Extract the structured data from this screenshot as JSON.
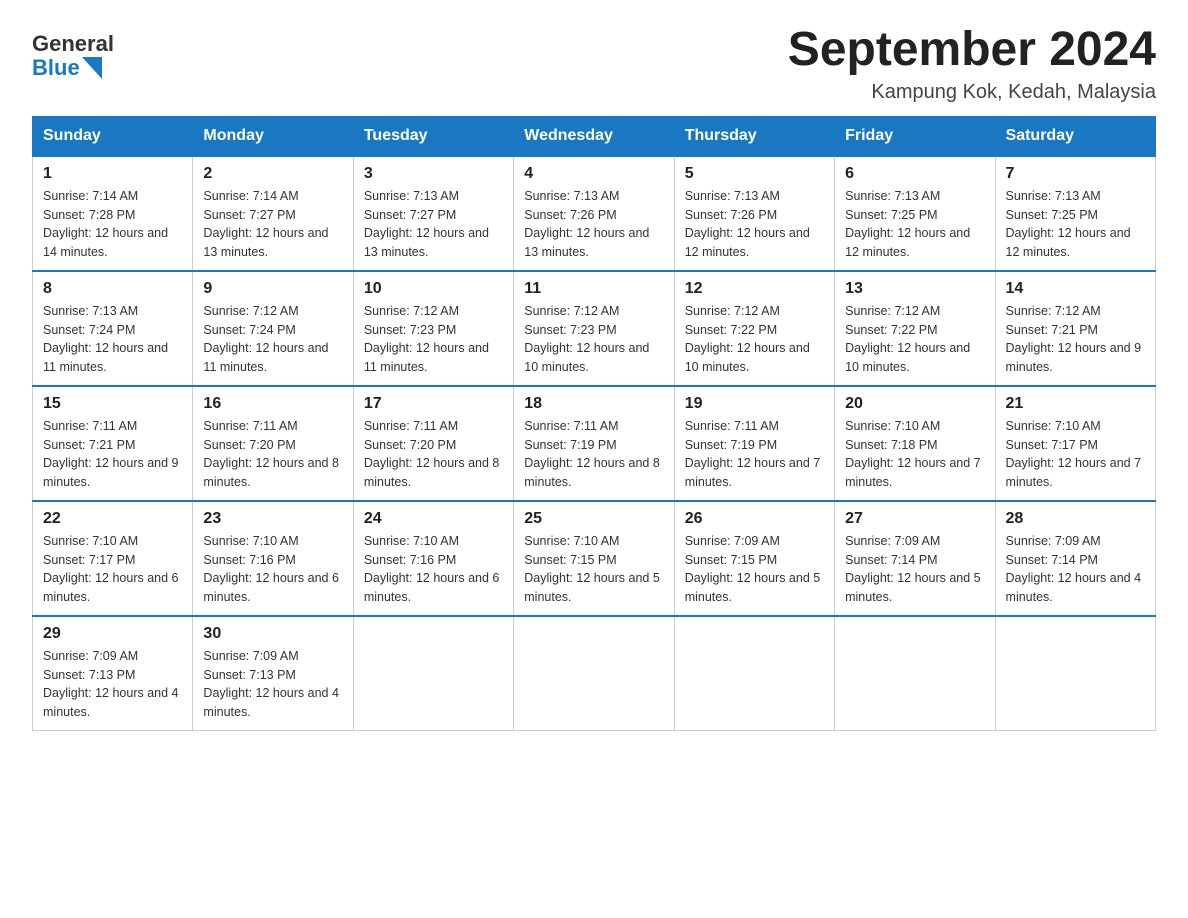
{
  "logo": {
    "text_general": "General",
    "text_blue": "Blue"
  },
  "title": "September 2024",
  "location": "Kampung Kok, Kedah, Malaysia",
  "days_of_week": [
    "Sunday",
    "Monday",
    "Tuesday",
    "Wednesday",
    "Thursday",
    "Friday",
    "Saturday"
  ],
  "weeks": [
    [
      {
        "day": "1",
        "sunrise": "7:14 AM",
        "sunset": "7:28 PM",
        "daylight": "12 hours and 14 minutes."
      },
      {
        "day": "2",
        "sunrise": "7:14 AM",
        "sunset": "7:27 PM",
        "daylight": "12 hours and 13 minutes."
      },
      {
        "day": "3",
        "sunrise": "7:13 AM",
        "sunset": "7:27 PM",
        "daylight": "12 hours and 13 minutes."
      },
      {
        "day": "4",
        "sunrise": "7:13 AM",
        "sunset": "7:26 PM",
        "daylight": "12 hours and 13 minutes."
      },
      {
        "day": "5",
        "sunrise": "7:13 AM",
        "sunset": "7:26 PM",
        "daylight": "12 hours and 12 minutes."
      },
      {
        "day": "6",
        "sunrise": "7:13 AM",
        "sunset": "7:25 PM",
        "daylight": "12 hours and 12 minutes."
      },
      {
        "day": "7",
        "sunrise": "7:13 AM",
        "sunset": "7:25 PM",
        "daylight": "12 hours and 12 minutes."
      }
    ],
    [
      {
        "day": "8",
        "sunrise": "7:13 AM",
        "sunset": "7:24 PM",
        "daylight": "12 hours and 11 minutes."
      },
      {
        "day": "9",
        "sunrise": "7:12 AM",
        "sunset": "7:24 PM",
        "daylight": "12 hours and 11 minutes."
      },
      {
        "day": "10",
        "sunrise": "7:12 AM",
        "sunset": "7:23 PM",
        "daylight": "12 hours and 11 minutes."
      },
      {
        "day": "11",
        "sunrise": "7:12 AM",
        "sunset": "7:23 PM",
        "daylight": "12 hours and 10 minutes."
      },
      {
        "day": "12",
        "sunrise": "7:12 AM",
        "sunset": "7:22 PM",
        "daylight": "12 hours and 10 minutes."
      },
      {
        "day": "13",
        "sunrise": "7:12 AM",
        "sunset": "7:22 PM",
        "daylight": "12 hours and 10 minutes."
      },
      {
        "day": "14",
        "sunrise": "7:12 AM",
        "sunset": "7:21 PM",
        "daylight": "12 hours and 9 minutes."
      }
    ],
    [
      {
        "day": "15",
        "sunrise": "7:11 AM",
        "sunset": "7:21 PM",
        "daylight": "12 hours and 9 minutes."
      },
      {
        "day": "16",
        "sunrise": "7:11 AM",
        "sunset": "7:20 PM",
        "daylight": "12 hours and 8 minutes."
      },
      {
        "day": "17",
        "sunrise": "7:11 AM",
        "sunset": "7:20 PM",
        "daylight": "12 hours and 8 minutes."
      },
      {
        "day": "18",
        "sunrise": "7:11 AM",
        "sunset": "7:19 PM",
        "daylight": "12 hours and 8 minutes."
      },
      {
        "day": "19",
        "sunrise": "7:11 AM",
        "sunset": "7:19 PM",
        "daylight": "12 hours and 7 minutes."
      },
      {
        "day": "20",
        "sunrise": "7:10 AM",
        "sunset": "7:18 PM",
        "daylight": "12 hours and 7 minutes."
      },
      {
        "day": "21",
        "sunrise": "7:10 AM",
        "sunset": "7:17 PM",
        "daylight": "12 hours and 7 minutes."
      }
    ],
    [
      {
        "day": "22",
        "sunrise": "7:10 AM",
        "sunset": "7:17 PM",
        "daylight": "12 hours and 6 minutes."
      },
      {
        "day": "23",
        "sunrise": "7:10 AM",
        "sunset": "7:16 PM",
        "daylight": "12 hours and 6 minutes."
      },
      {
        "day": "24",
        "sunrise": "7:10 AM",
        "sunset": "7:16 PM",
        "daylight": "12 hours and 6 minutes."
      },
      {
        "day": "25",
        "sunrise": "7:10 AM",
        "sunset": "7:15 PM",
        "daylight": "12 hours and 5 minutes."
      },
      {
        "day": "26",
        "sunrise": "7:09 AM",
        "sunset": "7:15 PM",
        "daylight": "12 hours and 5 minutes."
      },
      {
        "day": "27",
        "sunrise": "7:09 AM",
        "sunset": "7:14 PM",
        "daylight": "12 hours and 5 minutes."
      },
      {
        "day": "28",
        "sunrise": "7:09 AM",
        "sunset": "7:14 PM",
        "daylight": "12 hours and 4 minutes."
      }
    ],
    [
      {
        "day": "29",
        "sunrise": "7:09 AM",
        "sunset": "7:13 PM",
        "daylight": "12 hours and 4 minutes."
      },
      {
        "day": "30",
        "sunrise": "7:09 AM",
        "sunset": "7:13 PM",
        "daylight": "12 hours and 4 minutes."
      },
      null,
      null,
      null,
      null,
      null
    ]
  ]
}
